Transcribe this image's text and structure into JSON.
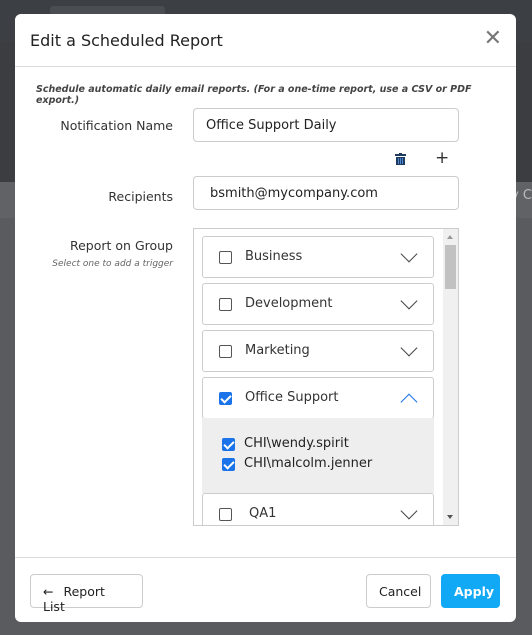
{
  "background": {
    "partial_text": "y C"
  },
  "modal": {
    "title": "Edit a Scheduled Report",
    "note": "Schedule automatic daily email reports. (For a one-time report, use a CSV or PDF export.)",
    "notification_label": "Notification Name",
    "notification_value": "Office Support Daily",
    "recipients_label": "Recipients",
    "recipients_value": "bsmith@mycompany.com",
    "group_label": "Report on Group",
    "group_hint": "Select one to add a trigger",
    "groups": [
      {
        "name": "Business",
        "checked": false,
        "expanded": false
      },
      {
        "name": "Development",
        "checked": false,
        "expanded": false
      },
      {
        "name": "Marketing",
        "checked": false,
        "expanded": false
      },
      {
        "name": "Office Support",
        "checked": true,
        "expanded": true
      },
      {
        "name": "QA1",
        "checked": false,
        "expanded": false
      }
    ],
    "members": [
      {
        "name": "CHI\\wendy.spirit",
        "checked": true
      },
      {
        "name": "CHI\\malcolm.jenner",
        "checked": true
      }
    ],
    "footer": {
      "report_list": "Report List",
      "cancel": "Cancel",
      "apply": "Apply"
    },
    "colors": {
      "accent": "#11a9f5",
      "checkbox": "#1a73e8"
    }
  }
}
